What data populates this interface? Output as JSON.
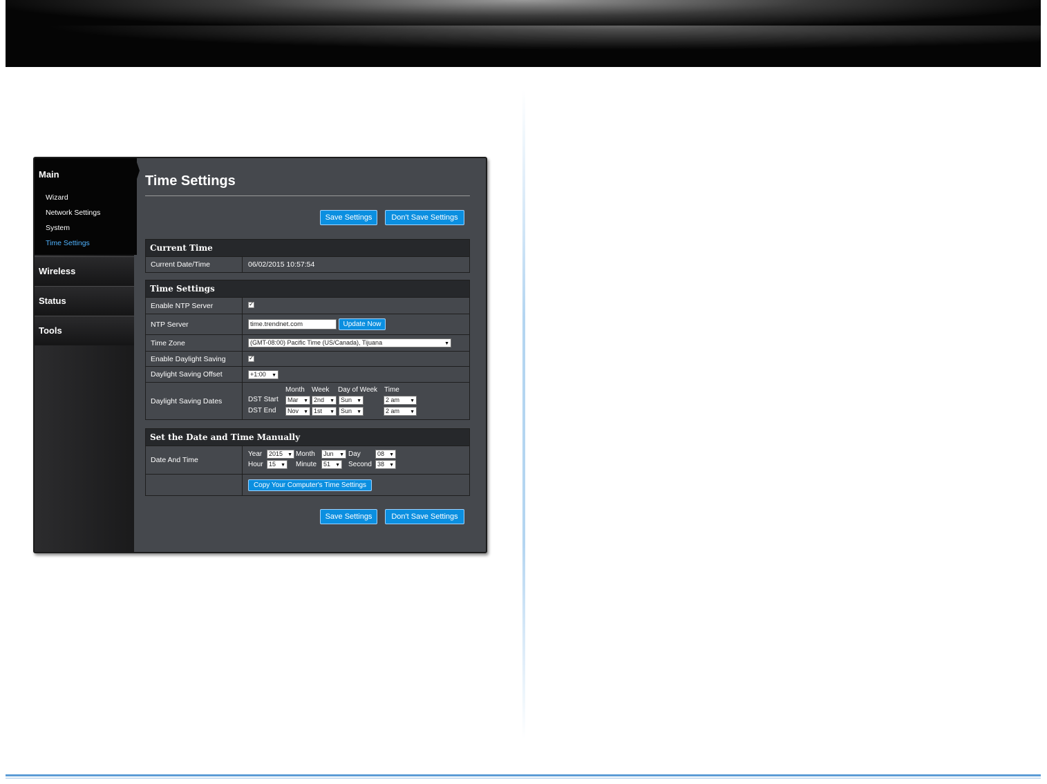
{
  "sidebar": {
    "main_heading": "Main",
    "main_items": [
      "Wizard",
      "Network Settings",
      "System",
      "Time Settings"
    ],
    "sections": [
      "Wireless",
      "Status",
      "Tools"
    ]
  },
  "page": {
    "title": "Time Settings"
  },
  "buttons": {
    "save": "Save Settings",
    "dont_save": "Don't Save Settings"
  },
  "current_time": {
    "heading": "Current Time",
    "label": "Current Date/Time",
    "value": "06/02/2015 10:57:54"
  },
  "time_settings": {
    "heading": "Time Settings",
    "enable_ntp_label": "Enable NTP Server",
    "enable_ntp_checked": true,
    "ntp_server_label": "NTP Server",
    "ntp_server_value": "time.trendnet.com",
    "update_now": "Update Now",
    "time_zone_label": "Time Zone",
    "time_zone_value": "(GMT-08:00) Pacific Time (US/Canada), Tijuana",
    "enable_dst_label": "Enable Daylight Saving",
    "enable_dst_checked": true,
    "dst_offset_label": "Daylight Saving Offset",
    "dst_offset_value": "+1:00",
    "dst_dates_label": "Daylight Saving Dates",
    "col_month": "Month",
    "col_week": "Week",
    "col_dow": "Day of Week",
    "col_time": "Time",
    "dst_start_label": "DST Start",
    "dst_start": {
      "month": "Mar",
      "week": "2nd",
      "dow": "Sun",
      "time": "2 am"
    },
    "dst_end_label": "DST End",
    "dst_end": {
      "month": "Nov",
      "week": "1st",
      "dow": "Sun",
      "time": "2 am"
    }
  },
  "manual": {
    "heading": "Set the Date and Time Manually",
    "label": "Date And Time",
    "year_label": "Year",
    "year": "2015",
    "month_label": "Month",
    "month": "Jun",
    "day_label": "Day",
    "day": "08",
    "hour_label": "Hour",
    "hour": "15",
    "minute_label": "Minute",
    "minute": "51",
    "second_label": "Second",
    "second": "38",
    "copy_button": "Copy Your Computer's Time Settings"
  },
  "colors": {
    "accent": "#0b8fe0",
    "active_nav": "#4fb3ff",
    "panel_bg": "#45484d"
  }
}
